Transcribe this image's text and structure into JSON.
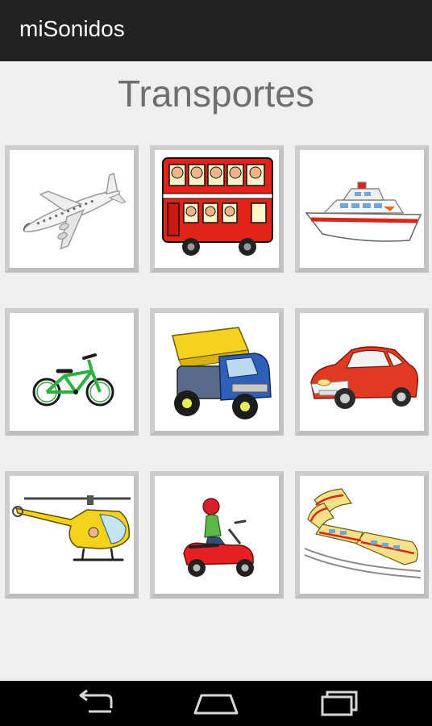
{
  "app_bar": {
    "title": "miSonidos"
  },
  "screen": {
    "title": "Transportes"
  },
  "tiles": [
    {
      "icon": "airplane-icon"
    },
    {
      "icon": "bus-icon"
    },
    {
      "icon": "boat-icon"
    },
    {
      "icon": "bicycle-icon"
    },
    {
      "icon": "dump-truck-icon"
    },
    {
      "icon": "car-icon"
    },
    {
      "icon": "helicopter-icon"
    },
    {
      "icon": "scooter-icon"
    },
    {
      "icon": "train-icon"
    }
  ],
  "nav_bar": {
    "buttons": [
      {
        "icon": "back-icon"
      },
      {
        "icon": "home-icon"
      },
      {
        "icon": "recent-apps-icon"
      }
    ]
  },
  "colors": {
    "action_bar": "#222222",
    "background": "#efefef",
    "tile_border": "#cdcdcd",
    "title_text": "#6e6e6e",
    "nav_bar": "#000000"
  }
}
